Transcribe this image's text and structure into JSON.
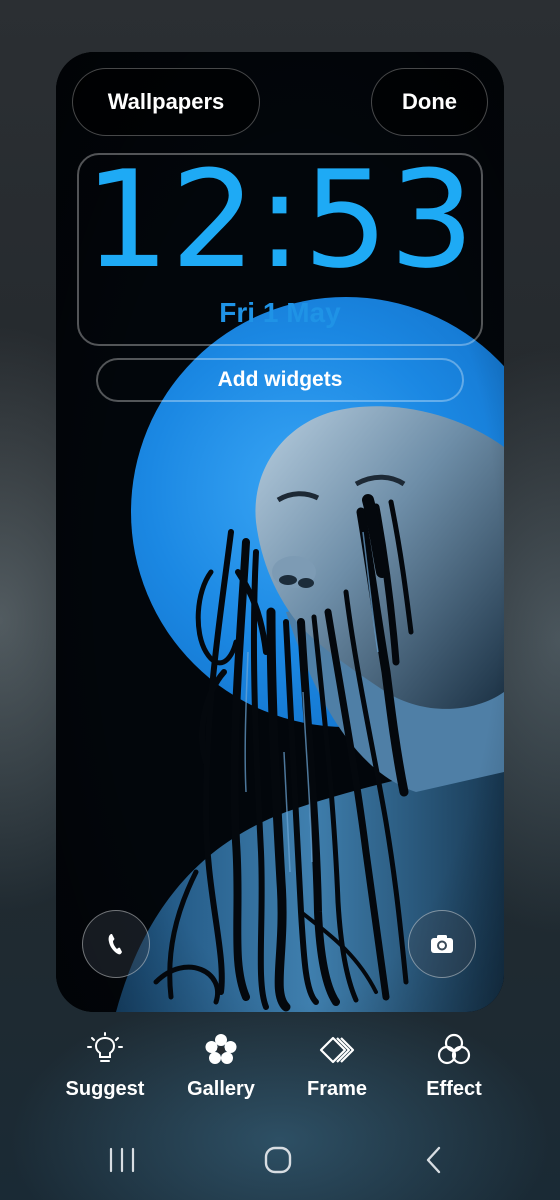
{
  "header": {
    "wallpapers_label": "Wallpapers",
    "done_label": "Done"
  },
  "lock_screen": {
    "time": "12:53",
    "date": "Fri 1 May",
    "add_widgets_label": "Add widgets",
    "shortcuts": [
      {
        "name": "phone-icon"
      },
      {
        "name": "camera-icon"
      }
    ]
  },
  "toolbar": {
    "items": [
      {
        "label": "Suggest",
        "icon": "lightbulb-icon"
      },
      {
        "label": "Gallery",
        "icon": "flower-icon"
      },
      {
        "label": "Frame",
        "icon": "frame-icon"
      },
      {
        "label": "Effect",
        "icon": "effect-icon"
      }
    ]
  },
  "navbar": {
    "items": [
      {
        "icon": "recents-icon"
      },
      {
        "icon": "home-icon"
      },
      {
        "icon": "back-icon"
      }
    ]
  },
  "colors": {
    "clock": "#1eaaf5",
    "date": "#1f93e6",
    "accent_circle": "#1a8ee8"
  }
}
